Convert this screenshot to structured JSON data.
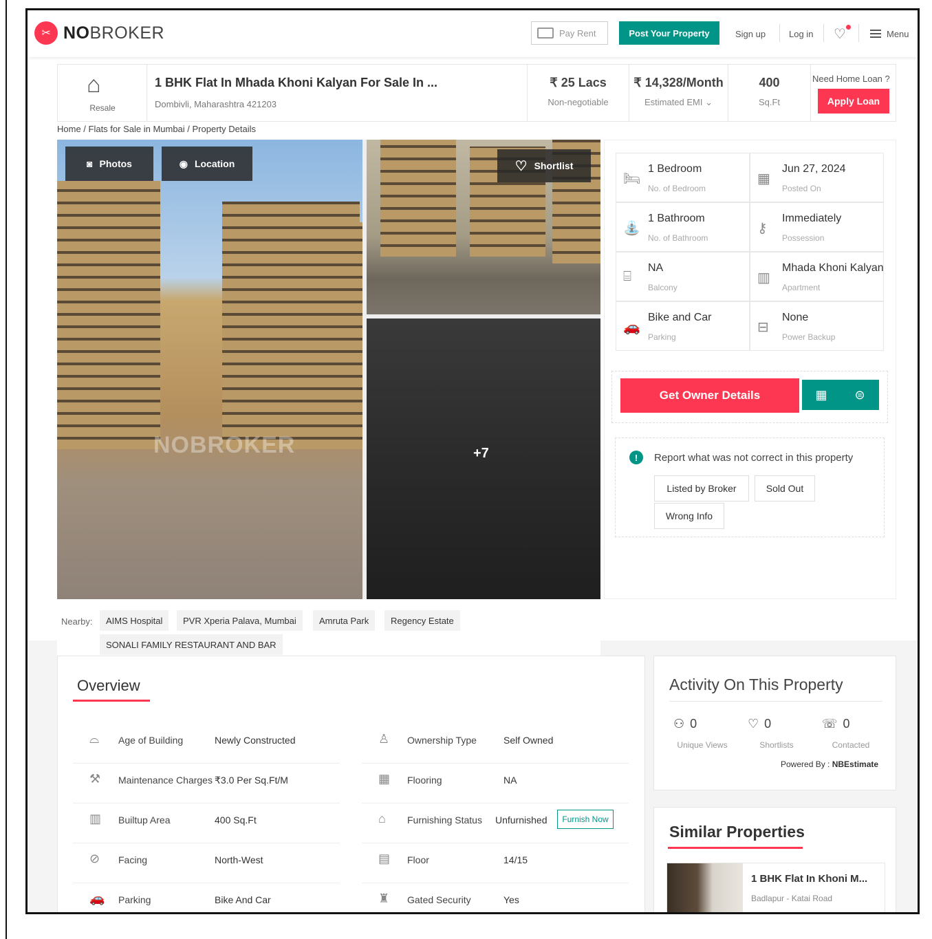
{
  "header": {
    "brand_bold": "NO",
    "brand_rest": "BROKER",
    "pay_rent": "Pay Rent",
    "post_property": "Post Your Property",
    "sign_up": "Sign up",
    "log_in": "Log in",
    "menu": "Menu"
  },
  "summary": {
    "type_label": "Resale",
    "title": "1 BHK Flat In Mhada Khoni Kalyan For Sale In ...",
    "address": "Dombivli, Maharashtra 421203",
    "price": "₹ 25 Lacs",
    "price_note": "Non-negotiable",
    "emi": "₹ 14,328/Month",
    "emi_note": "Estimated EMI ",
    "area": "400",
    "area_unit": "Sq.Ft",
    "loan_question": "Need Home Loan ?",
    "apply_loan": "Apply Loan"
  },
  "breadcrumb": "Home / Flats for Sale in Mumbai / Property Details",
  "gallery": {
    "photos_btn": "Photos",
    "location_btn": "Location",
    "shortlist_btn": "Shortlist",
    "more_count": "+7",
    "watermark": "NOBROKER"
  },
  "details": [
    {
      "value": "1 Bedroom",
      "label": "No. of Bedroom",
      "icon": "bed-icon"
    },
    {
      "value": "Jun 27, 2024",
      "label": "Posted On",
      "icon": "calendar-icon"
    },
    {
      "value": "1 Bathroom",
      "label": "No. of Bathroom",
      "icon": "bath-icon"
    },
    {
      "value": "Immediately",
      "label": "Possession",
      "icon": "key-icon"
    },
    {
      "value": "NA",
      "label": "Balcony",
      "icon": "balcony-icon"
    },
    {
      "value": "Mhada Khoni Kalyan",
      "label": "Apartment",
      "icon": "building-icon"
    },
    {
      "value": "Bike and Car",
      "label": "Parking",
      "icon": "car-icon"
    },
    {
      "value": "None",
      "label": "Power Backup",
      "icon": "battery-icon"
    }
  ],
  "owner": {
    "get_owner": "Get Owner Details"
  },
  "report": {
    "text": "Report what was not correct in this property",
    "options": [
      "Listed by Broker",
      "Sold Out",
      "Wrong Info"
    ]
  },
  "nearby": {
    "label": "Nearby:",
    "places": [
      "AIMS Hospital",
      "PVR Xperia Palava, Mumbai",
      "Amruta Park",
      "Regency Estate",
      "SONALI FAMILY RESTAURANT AND BAR"
    ]
  },
  "overview": {
    "title": "Overview",
    "left": [
      {
        "key": "Age of Building",
        "value": "Newly Constructed",
        "icon": "cake-icon"
      },
      {
        "key": "Maintenance Charges",
        "value": "₹3.0 Per Sq.Ft/M",
        "icon": "hammer-icon"
      },
      {
        "key": "Builtup Area",
        "value": "400 Sq.Ft",
        "icon": "building-area-icon"
      },
      {
        "key": "Facing",
        "value": "North-West",
        "icon": "compass-icon"
      },
      {
        "key": "Parking",
        "value": "Bike And Car",
        "icon": "car-icon"
      }
    ],
    "right": [
      {
        "key": "Ownership Type",
        "value": "Self Owned",
        "icon": "owner-icon"
      },
      {
        "key": "Flooring",
        "value": "NA",
        "icon": "flooring-icon"
      },
      {
        "key": "Furnishing Status",
        "value": "Unfurnished",
        "icon": "sofa-icon"
      },
      {
        "key": "Floor",
        "value": "14/15",
        "icon": "floor-icon"
      },
      {
        "key": "Gated Security",
        "value": "Yes",
        "icon": "guard-icon"
      }
    ],
    "furnish_now": "Furnish Now"
  },
  "activity": {
    "title": "Activity On This Property",
    "stats": [
      {
        "value": "0",
        "label": "Unique Views",
        "icon": "user-icon"
      },
      {
        "value": "0",
        "label": "Shortlists",
        "icon": "heart-icon"
      },
      {
        "value": "0",
        "label": "Contacted",
        "icon": "phone-icon"
      }
    ],
    "powered_by": "Powered By :",
    "powered_name": "NBEstimate"
  },
  "similar": {
    "title": "Similar Properties",
    "items": [
      {
        "name": "1 BHK Flat In Khoni M...",
        "location": "Badlapur - Katai Road"
      }
    ]
  }
}
